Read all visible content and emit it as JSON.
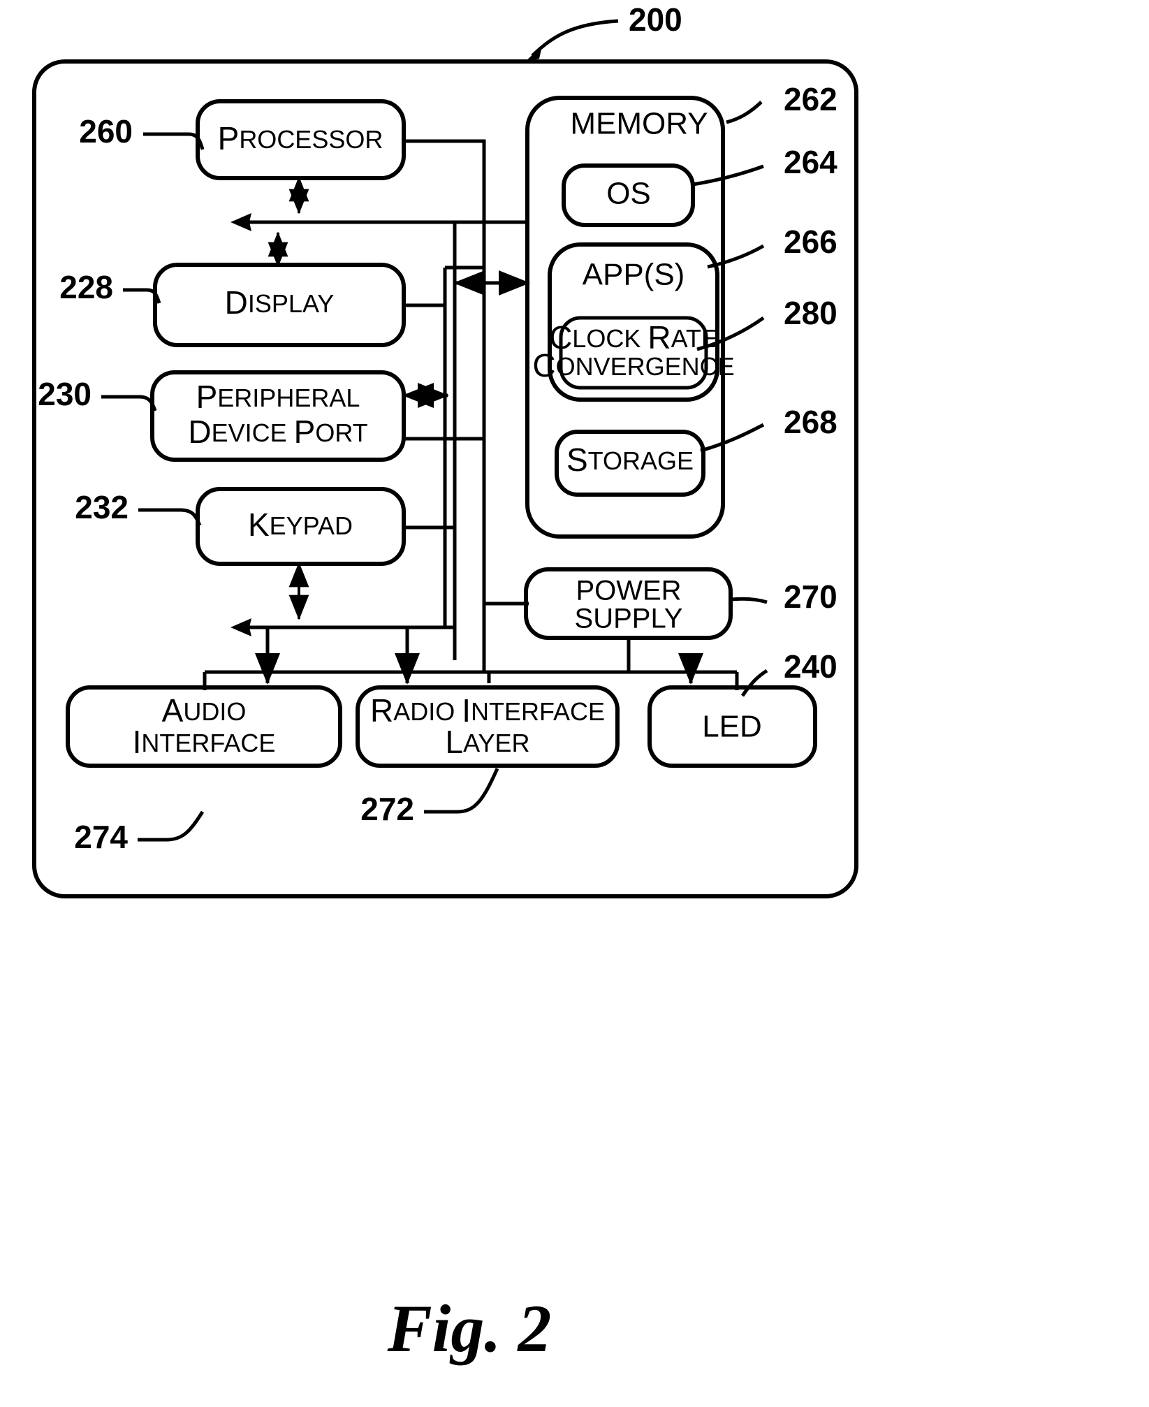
{
  "figure": {
    "caption": "Fig. 2",
    "outer_ref": "200"
  },
  "blocks": {
    "processor": {
      "label": "Processor",
      "ref": "260"
    },
    "display": {
      "label": "Display",
      "ref": "228"
    },
    "peripheral_device_port": {
      "line1": "Peripheral",
      "line2": "Device Port",
      "ref": "230"
    },
    "keypad": {
      "label": "Keypad",
      "ref": "232"
    },
    "memory": {
      "label": "MEMORY",
      "ref": "262"
    },
    "os": {
      "label": "OS",
      "ref": "264"
    },
    "apps": {
      "label": "APP(S)",
      "ref": "266"
    },
    "clock_rate_convergence": {
      "line1": "Clock Rate",
      "line2": "Convergence",
      "ref": "280"
    },
    "storage": {
      "label": "Storage",
      "ref": "268"
    },
    "power_supply": {
      "line1": "POWER",
      "line2": "SUPPLY",
      "ref": "270"
    },
    "audio_interface": {
      "line1": "Audio",
      "line2": "Interface",
      "ref": "274"
    },
    "radio_interface_layer": {
      "line1": "Radio Interface",
      "line2": "Layer",
      "ref": "272"
    },
    "led": {
      "label": "LED",
      "ref": "240"
    }
  },
  "colors": {
    "ink": "#000000",
    "paper": "#ffffff"
  }
}
